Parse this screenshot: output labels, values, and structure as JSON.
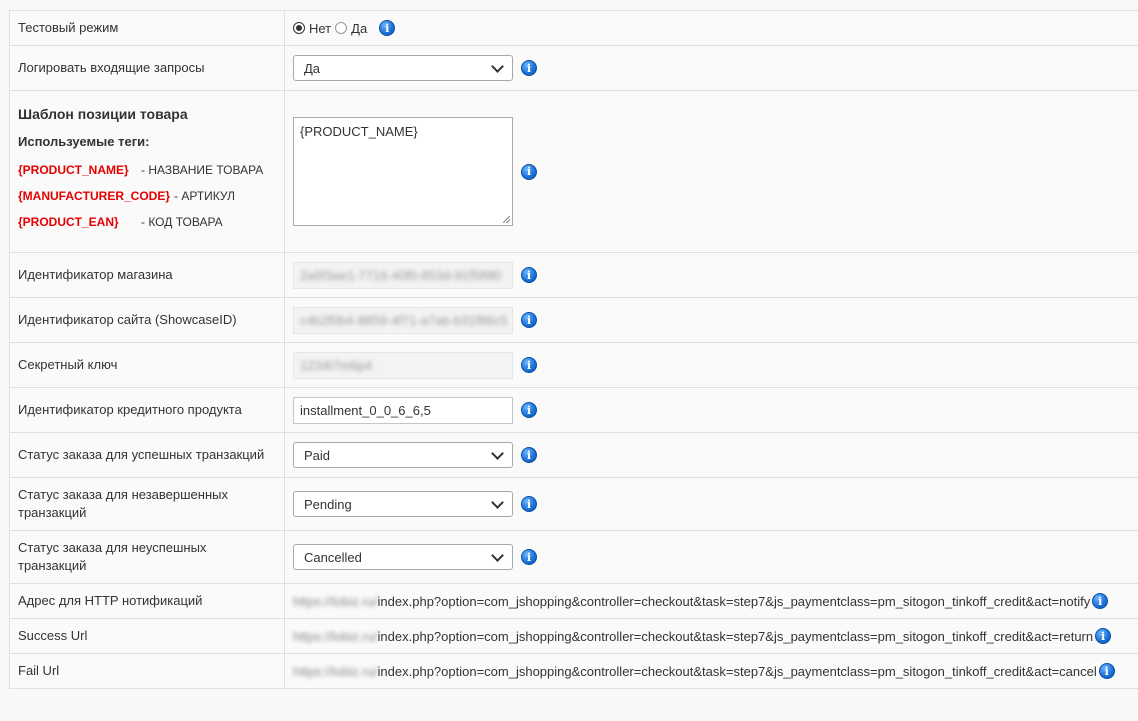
{
  "rows": {
    "test_mode": {
      "label": "Тестовый режим",
      "option_no": "Нет",
      "option_yes": "Да",
      "selected": "Нет"
    },
    "log_requests": {
      "label": "Логировать входящие запросы",
      "value": "Да"
    },
    "template": {
      "title": "Шаблон позиции товара",
      "tags_heading": "Используемые теги:",
      "tags": [
        {
          "tag": "{PRODUCT_NAME}",
          "desc": "- НАЗВАНИЕ ТОВАРА"
        },
        {
          "tag": "{MANUFACTURER_CODE}",
          "desc": "- АРТИКУЛ"
        },
        {
          "tag": "{PRODUCT_EAN}",
          "desc": "- КОД ТОВАРА"
        }
      ],
      "value": "{PRODUCT_NAME}"
    },
    "shop_id": {
      "label": "Идентификатор магазина",
      "value": "2a5f3ae1-7716-40f0-853d-91f5f9f0"
    },
    "showcase_id": {
      "label": "Идентификатор сайта (ShowcaseID)",
      "value": "c4b2f0b4-8859-4f71-a7ab-b31f86c5"
    },
    "secret_key": {
      "label": "Секретный ключ",
      "value": "1234t7m6p4"
    },
    "credit_product": {
      "label": "Идентификатор кредитного продукта",
      "value": "installment_0_0_6_6,5"
    },
    "status_success": {
      "label": "Статус заказа для успешных транзакций",
      "value": "Paid"
    },
    "status_pending": {
      "label": "Статус заказа для незавершенных транзакций",
      "value": "Pending"
    },
    "status_failed": {
      "label": "Статус заказа для неуспешных транзакций",
      "value": "Cancelled"
    },
    "http_notify": {
      "label": "Адрес для HTTP нотификаций",
      "host": "https://lobiz.ru/",
      "path": "index.php?option=com_jshopping&controller=checkout&task=step7&js_paymentclass=pm_sitogon_tinkoff_credit&act=notify"
    },
    "success_url": {
      "label": "Success Url",
      "host": "https://lobiz.ru/",
      "path": "index.php?option=com_jshopping&controller=checkout&task=step7&js_paymentclass=pm_sitogon_tinkoff_credit&act=return"
    },
    "fail_url": {
      "label": "Fail Url",
      "host": "https://lobiz.ru/",
      "path": "index.php?option=com_jshopping&controller=checkout&task=step7&js_paymentclass=pm_sitogon_tinkoff_credit&act=cancel"
    }
  },
  "icons": {
    "info": "info-icon",
    "chevron": "chevron-down-icon"
  },
  "info_glyph": "i"
}
